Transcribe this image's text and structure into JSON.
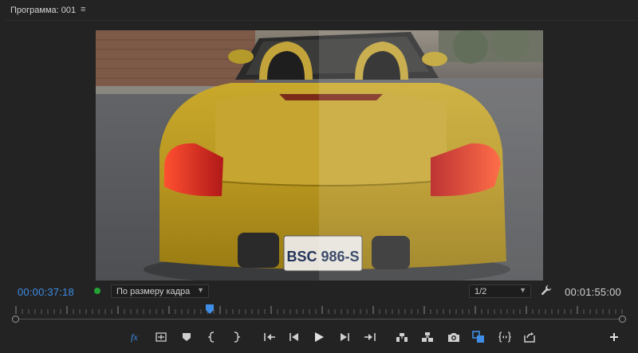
{
  "panel": {
    "title": "Программа: 001",
    "menu_glyph": "≡"
  },
  "viewer": {
    "license_plate": "BSC 986-S"
  },
  "playback": {
    "current_timecode": "00:00:37:18",
    "total_duration": "00:01:55:00",
    "zoom_selected": "По размеру кадра",
    "resolution_selected": "1/2",
    "status_color": "#25a235",
    "accent_color": "#3e8de6"
  },
  "toolbar": {
    "buttons": [
      "fx-icon",
      "insert-overlay-icon",
      "marker-icon",
      "mark-in-icon",
      "mark-out-icon",
      "go-to-in-icon",
      "step-back-icon",
      "play-icon",
      "step-forward-icon",
      "go-to-out-icon",
      "lift-icon",
      "extract-icon",
      "camera-icon",
      "comparison-view-icon",
      "trim-icon",
      "export-icon",
      "add-icon"
    ]
  }
}
